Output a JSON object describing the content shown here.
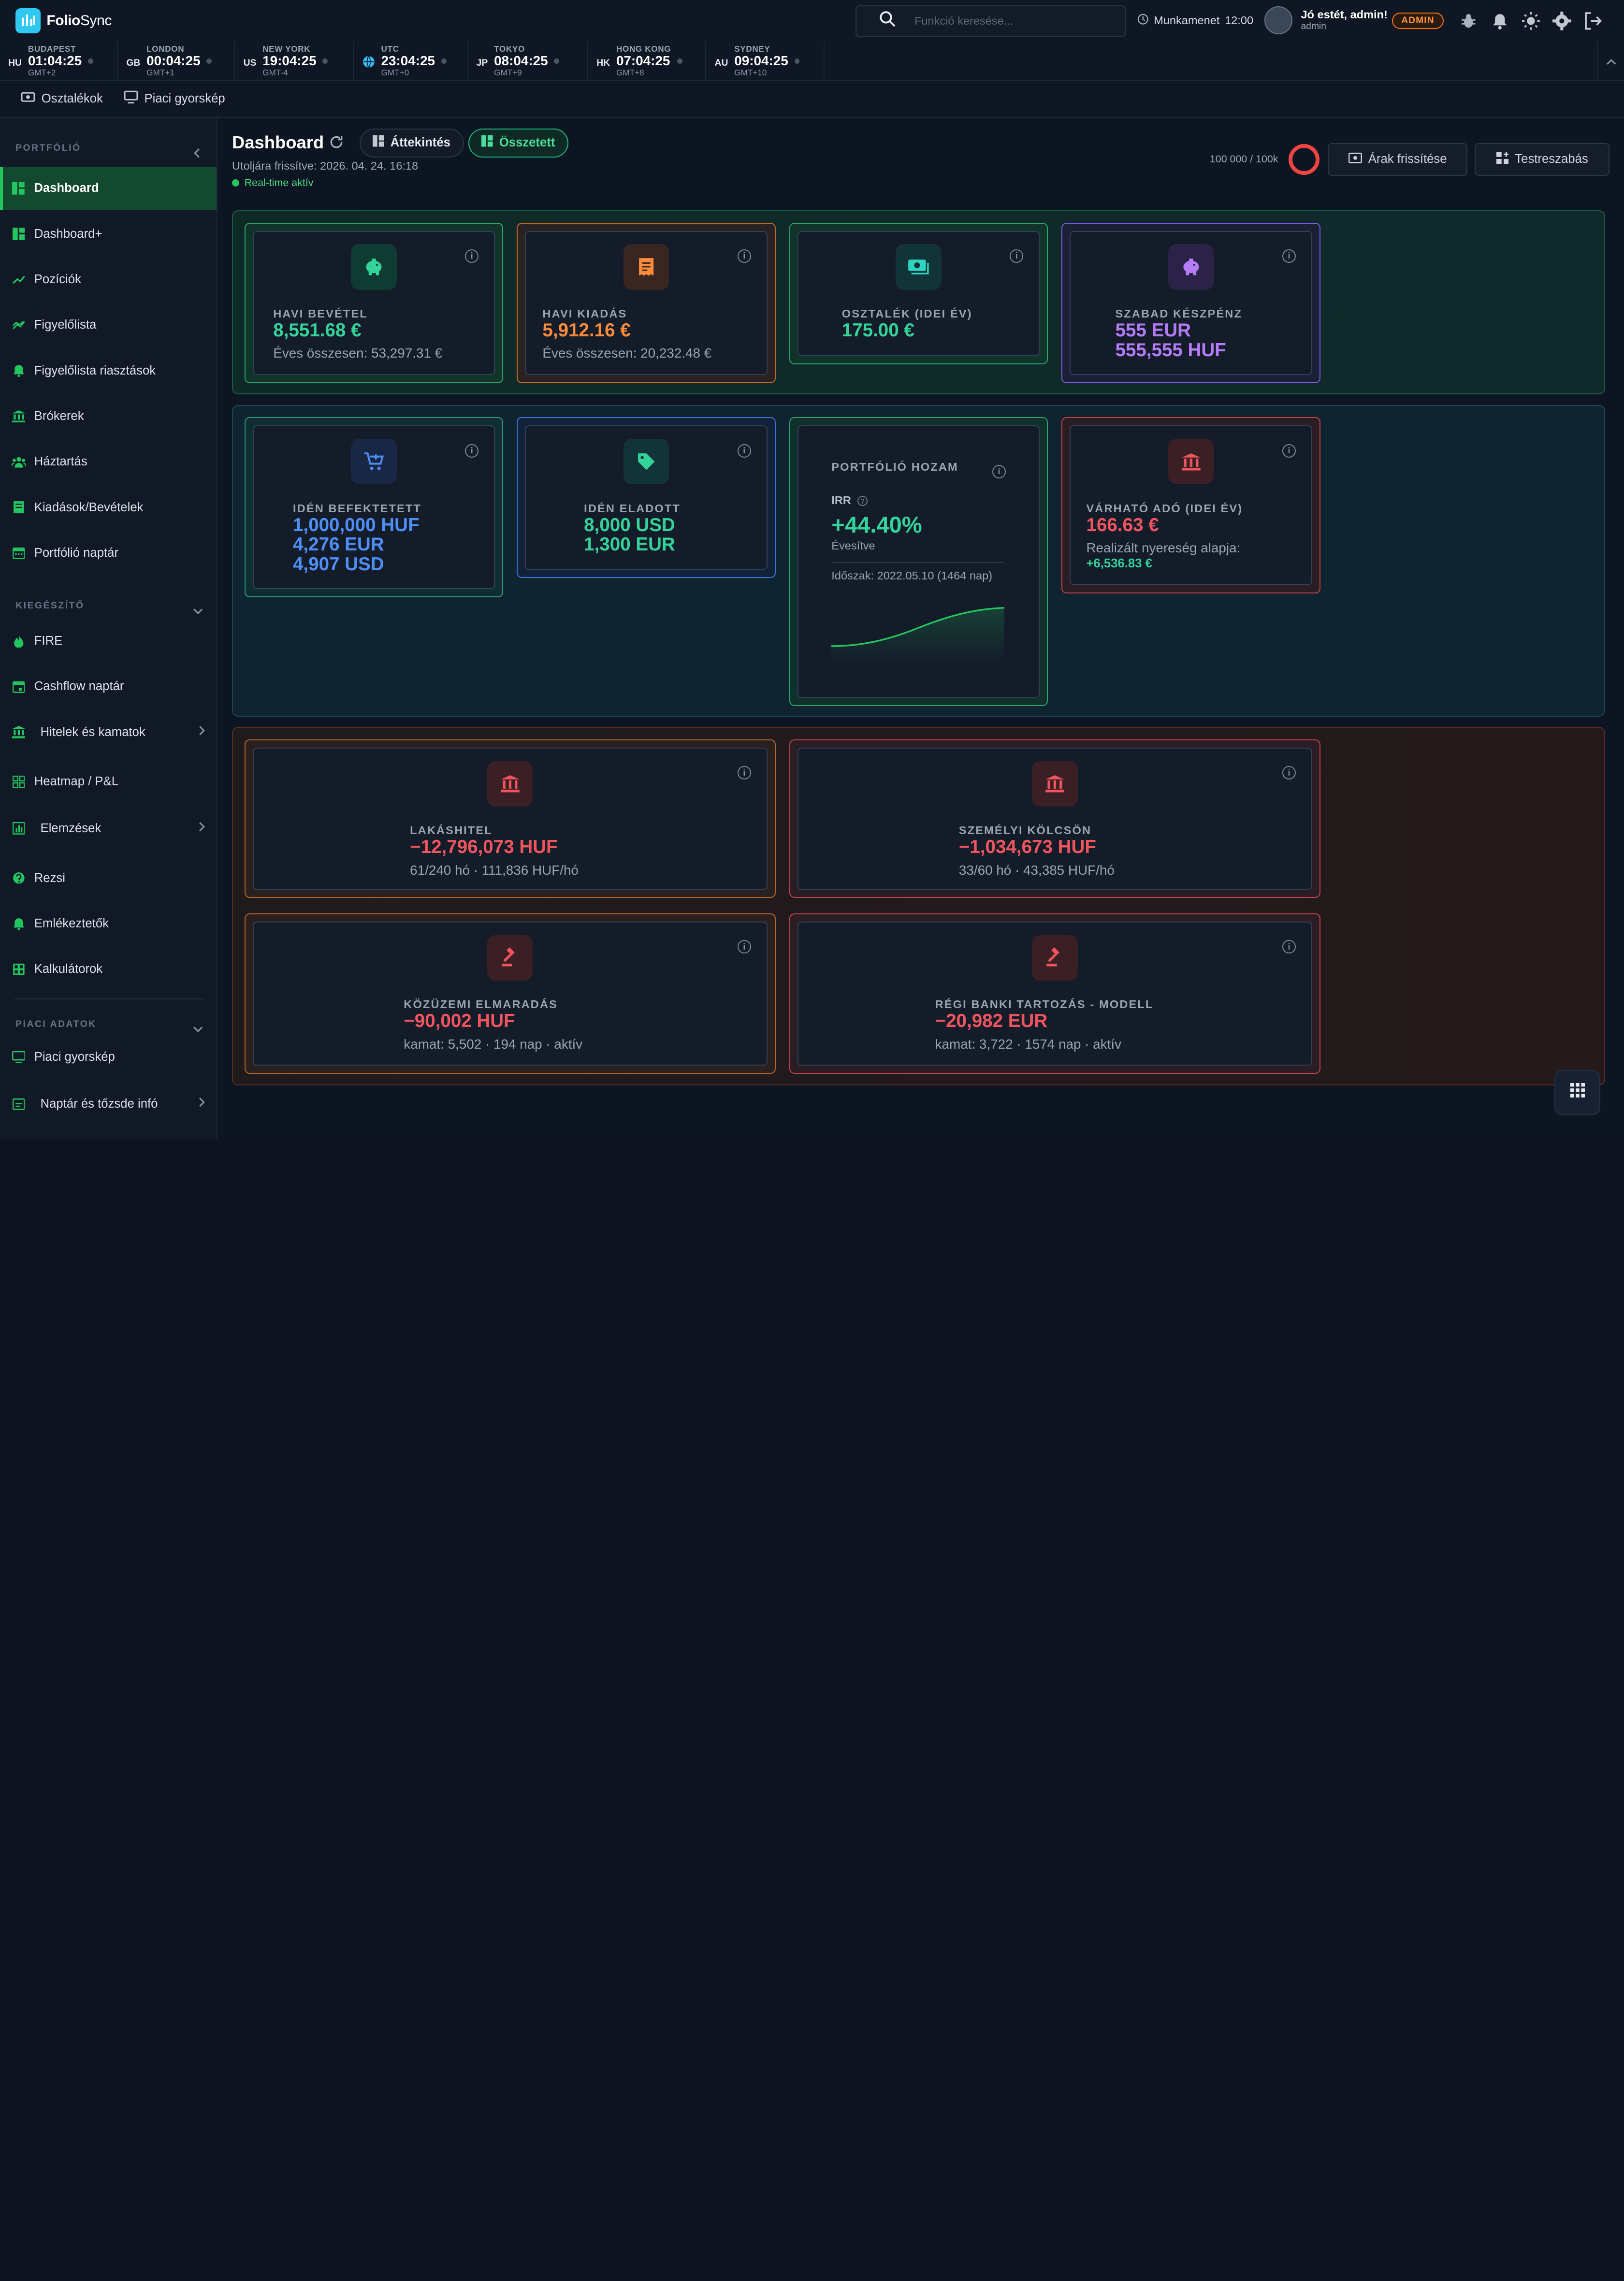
{
  "app": {
    "name_bold": "Folio",
    "name_rest": "Sync"
  },
  "search": {
    "placeholder": "Funkció keresése..."
  },
  "session": {
    "label": "Munkamenet",
    "time": "12:00"
  },
  "user": {
    "greeting": "Jó estét, admin!",
    "username": "admin",
    "role_badge": "ADMIN"
  },
  "clocks": [
    {
      "cc": "HU",
      "city": "BUDAPEST",
      "time": "01:04:25",
      "gmt": "GMT+2"
    },
    {
      "cc": "GB",
      "city": "LONDON",
      "time": "00:04:25",
      "gmt": "GMT+1"
    },
    {
      "cc": "US",
      "city": "NEW YORK",
      "time": "19:04:25",
      "gmt": "GMT-4"
    },
    {
      "cc": "",
      "city": "UTC",
      "time": "23:04:25",
      "gmt": "GMT+0"
    },
    {
      "cc": "JP",
      "city": "TOKYO",
      "time": "08:04:25",
      "gmt": "GMT+9"
    },
    {
      "cc": "HK",
      "city": "HONG KONG",
      "time": "07:04:25",
      "gmt": "GMT+8"
    },
    {
      "cc": "AU",
      "city": "SYDNEY",
      "time": "09:04:25",
      "gmt": "GMT+10"
    }
  ],
  "quickbar": {
    "dividends": "Osztalékok",
    "market_snapshot": "Piaci gyorskép"
  },
  "sidebar": {
    "section_portfolio": "PORTFÓLIÓ",
    "section_extra": "KIEGÉSZÍTŐ",
    "section_market": "PIACI ADATOK",
    "items": [
      "Dashboard",
      "Dashboard+",
      "Pozíciók",
      "Figyelőlista",
      "Figyelőlista riasztások",
      "Brókerek",
      "Háztartás",
      "Kiadások/Bevételek",
      "Portfólió naptár",
      "FIRE",
      "Cashflow naptár",
      "Hitelek és kamatok",
      "Heatmap / P&L",
      "Elemzések",
      "Rezsi",
      "Emlékeztetők",
      "Kalkulátorok",
      "Piaci gyorskép",
      "Naptár és tőzsde infó"
    ]
  },
  "header": {
    "title": "Dashboard",
    "view_overview": "Áttekintés",
    "view_combined": "Összetett",
    "last_update": "Utoljára frissítve: 2026. 04. 24. 16:18",
    "realtime": "Real-time aktív",
    "quota": "100 000 / 100k",
    "refresh_prices": "Árak frissítése",
    "customize": "Testreszabás"
  },
  "cards": {
    "income": {
      "label": "HAVI BEVÉTEL",
      "value": "8,551.68 €",
      "sub": "Éves összesen: 53,297.31 €"
    },
    "expense": {
      "label": "HAVI KIADÁS",
      "value": "5,912.16 €",
      "sub": "Éves összesen: 20,232.48 €"
    },
    "dividend": {
      "label": "OSZTALÉK (IDEI ÉV)",
      "value": "175.00 €"
    },
    "cash": {
      "label": "SZABAD KÉSZPÉNZ",
      "value1": "555 EUR",
      "value2": "555,555 HUF"
    },
    "invested": {
      "label": "IDÉN BEFEKTETETT",
      "value1": "1,000,000 HUF",
      "value2": "4,276 EUR",
      "value3": "4,907 USD"
    },
    "sold": {
      "label": "IDÉN ELADOTT",
      "value1": "8,000 USD",
      "value2": "1,300 EUR"
    },
    "yield": {
      "label": "PORTFÓLIÓ HOZAM",
      "irr_label": "IRR",
      "irr_value": "+44.40%",
      "annualized": "Évesítve",
      "period": "Időszak: 2022.05.10 (1464 nap)"
    },
    "tax": {
      "label": "VÁRHATÓ ADÓ (IDEI ÉV)",
      "value": "166.63 €",
      "sub": "Realizált nyereség alapja:",
      "sub_value": "+6,536.83 €"
    },
    "mortgage": {
      "label": "LAKÁSHITEL",
      "value": "−12,796,073 HUF",
      "sub": "61/240 hó · 111,836 HUF/hó"
    },
    "personal_loan": {
      "label": "SZEMÉLYI KÖLCSÖN",
      "value": "−1,034,673 HUF",
      "sub": "33/60 hó · 43,385 HUF/hó"
    },
    "utility_arrears": {
      "label": "KÖZÜZEMI ELMARADÁS",
      "value": "−90,002 HUF",
      "sub": "kamat: 5,502 · 194 nap · aktív"
    },
    "old_bank_debt": {
      "label": "RÉGI BANKI TARTOZÁS - MODELL",
      "value": "−20,982 EUR",
      "sub": "kamat: 3,722 · 1574 nap · aktív"
    }
  },
  "colors": {
    "accent_green": "#22c55e",
    "orange": "#fb8c3c",
    "purple": "#b57cf8",
    "blue": "#4d8ff7",
    "red": "#f0555e"
  }
}
